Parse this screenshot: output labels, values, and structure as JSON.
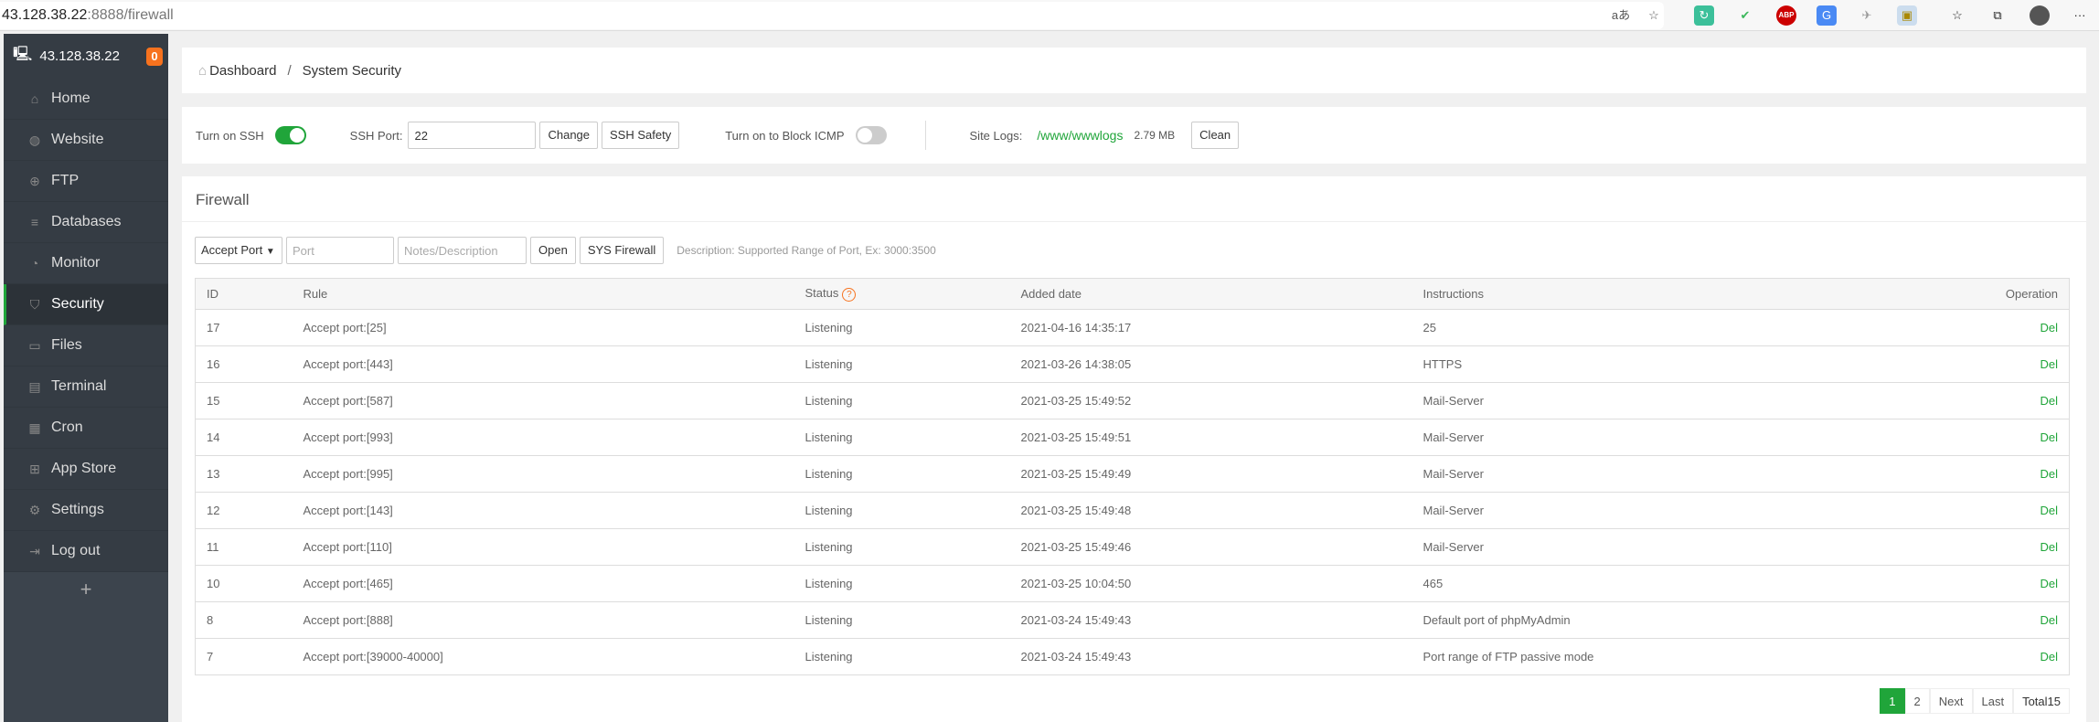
{
  "browser": {
    "url_host": "43.128.38.22",
    "url_rest": ":8888/firewall",
    "extensions": [
      "translate-icon",
      "favorite-add-icon",
      "sync-extension-icon",
      "shield-extension-icon",
      "adblock-icon",
      "google-translate-icon",
      "bird-extension-icon",
      "image-extension-icon",
      "favorites-icon",
      "collections-icon",
      "profile-avatar",
      "more-icon"
    ]
  },
  "sidebar": {
    "host": "43.128.38.22",
    "badge": "0",
    "items": [
      {
        "label": "Home",
        "icon": "home-icon"
      },
      {
        "label": "Website",
        "icon": "globe-icon"
      },
      {
        "label": "FTP",
        "icon": "ftp-icon"
      },
      {
        "label": "Databases",
        "icon": "database-icon"
      },
      {
        "label": "Monitor",
        "icon": "monitor-icon"
      },
      {
        "label": "Security",
        "icon": "shield-icon"
      },
      {
        "label": "Files",
        "icon": "folder-icon"
      },
      {
        "label": "Terminal",
        "icon": "terminal-icon"
      },
      {
        "label": "Cron",
        "icon": "calendar-icon"
      },
      {
        "label": "App Store",
        "icon": "apps-icon"
      },
      {
        "label": "Settings",
        "icon": "gear-icon"
      },
      {
        "label": "Log out",
        "icon": "logout-icon"
      }
    ],
    "add": "+"
  },
  "breadcrumb": {
    "home": "Dashboard",
    "sep": "/",
    "current": "System Security"
  },
  "ssh": {
    "ssh_label": "Turn on SSH",
    "ssh_on": true,
    "port_label": "SSH Port:",
    "port_value": "22",
    "change": "Change",
    "safety": "SSH Safety",
    "icmp_label": "Turn on to Block ICMP",
    "icmp_on": false,
    "logs_label": "Site Logs:",
    "logs_path": "/www/wwwlogs",
    "logs_size": "2.79 MB",
    "clean": "Clean"
  },
  "firewall": {
    "title": "Firewall",
    "select": "Accept Port",
    "port_placeholder": "Port",
    "notes_placeholder": "Notes/Description",
    "open": "Open",
    "sys": "SYS Firewall",
    "desc": "Description: Supported Range of Port,  Ex: 3000:3500",
    "columns": {
      "id": "ID",
      "rule": "Rule",
      "status": "Status",
      "date": "Added date",
      "instr": "Instructions",
      "op": "Operation"
    },
    "rows": [
      {
        "id": "17",
        "rule": "Accept port:[25]",
        "status": "Listening",
        "date": "2021-04-16 14:35:17",
        "instr": "25",
        "op": "Del"
      },
      {
        "id": "16",
        "rule": "Accept port:[443]",
        "status": "Listening",
        "date": "2021-03-26 14:38:05",
        "instr": "HTTPS",
        "op": "Del"
      },
      {
        "id": "15",
        "rule": "Accept port:[587]",
        "status": "Listening",
        "date": "2021-03-25 15:49:52",
        "instr": "Mail-Server",
        "op": "Del"
      },
      {
        "id": "14",
        "rule": "Accept port:[993]",
        "status": "Listening",
        "date": "2021-03-25 15:49:51",
        "instr": "Mail-Server",
        "op": "Del"
      },
      {
        "id": "13",
        "rule": "Accept port:[995]",
        "status": "Listening",
        "date": "2021-03-25 15:49:49",
        "instr": "Mail-Server",
        "op": "Del"
      },
      {
        "id": "12",
        "rule": "Accept port:[143]",
        "status": "Listening",
        "date": "2021-03-25 15:49:48",
        "instr": "Mail-Server",
        "op": "Del"
      },
      {
        "id": "11",
        "rule": "Accept port:[110]",
        "status": "Listening",
        "date": "2021-03-25 15:49:46",
        "instr": "Mail-Server",
        "op": "Del"
      },
      {
        "id": "10",
        "rule": "Accept port:[465]",
        "status": "Listening",
        "date": "2021-03-25 10:04:50",
        "instr": "465",
        "op": "Del"
      },
      {
        "id": "8",
        "rule": "Accept port:[888]",
        "status": "Listening",
        "date": "2021-03-24 15:49:43",
        "instr": "Default port of phpMyAdmin",
        "op": "Del"
      },
      {
        "id": "7",
        "rule": "Accept port:[39000-40000]",
        "status": "Listening",
        "date": "2021-03-24 15:49:43",
        "instr": "Port range of FTP passive mode",
        "op": "Del"
      }
    ],
    "pager": {
      "current": "1",
      "page2": "2",
      "next": "Next",
      "last": "Last",
      "total": "Total15"
    }
  },
  "colors": {
    "accent": "#20a53a",
    "badge": "#f7721e",
    "sidebar": "#3c444d"
  }
}
